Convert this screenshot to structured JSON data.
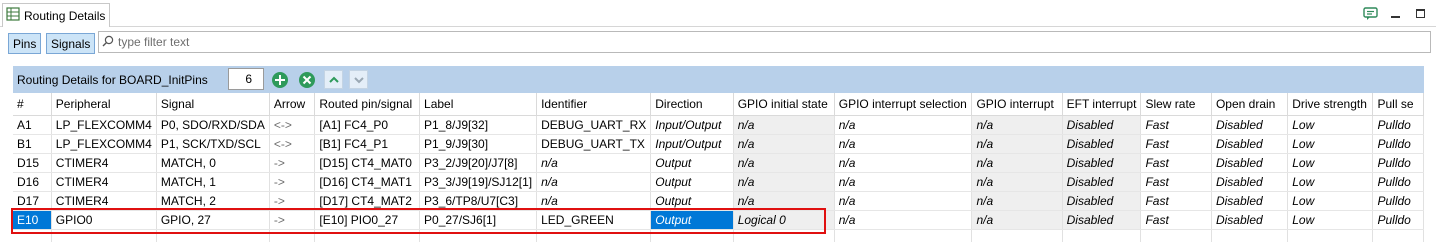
{
  "view": {
    "tab_title": "Routing Details"
  },
  "toolbar": {
    "pins_label": "Pins",
    "signals_label": "Signals",
    "filter_placeholder": "type filter text"
  },
  "routing": {
    "title": "Routing Details for BOARD_InitPins",
    "count": "6"
  },
  "table": {
    "columns": [
      "#",
      "Peripheral",
      "Signal",
      "Arrow",
      "Routed pin/signal",
      "Label",
      "Identifier",
      "Direction",
      "GPIO initial state",
      "GPIO interrupt selection",
      "GPIO interrupt",
      "EFT interrupt",
      "Slew rate",
      "Open drain",
      "Drive strength",
      "Pull se"
    ],
    "rows": [
      [
        "A1",
        "LP_FLEXCOMM4",
        "P0, SDO/RXD/SDA",
        "<->",
        "[A1] FC4_P0",
        "P1_8/J9[32]",
        "DEBUG_UART_RX",
        "Input/Output",
        "n/a",
        "n/a",
        "n/a",
        "Disabled",
        "Fast",
        "Disabled",
        "Low",
        "Pulldo"
      ],
      [
        "B1",
        "LP_FLEXCOMM4",
        "P1, SCK/TXD/SCL",
        "<->",
        "[B1] FC4_P1",
        "P1_9/J9[30]",
        "DEBUG_UART_TX",
        "Input/Output",
        "n/a",
        "n/a",
        "n/a",
        "Disabled",
        "Fast",
        "Disabled",
        "Low",
        "Pulldo"
      ],
      [
        "D15",
        "CTIMER4",
        "MATCH, 0",
        "->",
        "[D15] CT4_MAT0",
        "P3_2/J9[20]/J7[8]",
        "n/a",
        "Output",
        "n/a",
        "n/a",
        "n/a",
        "Disabled",
        "Fast",
        "Disabled",
        "Low",
        "Pulldo"
      ],
      [
        "D16",
        "CTIMER4",
        "MATCH, 1",
        "->",
        "[D16] CT4_MAT1",
        "P3_3/J9[19]/SJ12[1]",
        "n/a",
        "Output",
        "n/a",
        "n/a",
        "n/a",
        "Disabled",
        "Fast",
        "Disabled",
        "Low",
        "Pulldo"
      ],
      [
        "D17",
        "CTIMER4",
        "MATCH, 2",
        "->",
        "[D17] CT4_MAT2",
        "P3_6/TP8/U7[C3]",
        "n/a",
        "Output",
        "n/a",
        "n/a",
        "n/a",
        "Disabled",
        "Fast",
        "Disabled",
        "Low",
        "Pulldo"
      ],
      [
        "E10",
        "GPIO0",
        "GPIO, 27",
        "->",
        "[E10] PIO0_27",
        "P0_27/SJ6[1]",
        "LED_GREEN",
        "Output",
        "Logical 0",
        "n/a",
        "n/a",
        "Disabled",
        "Fast",
        "Disabled",
        "Low",
        "Pulldo"
      ]
    ],
    "selected_row": 5
  },
  "icons": {
    "view_icon": "routing-table-icon",
    "filter_icon": "search-icon",
    "add": "add-icon",
    "remove": "remove-icon",
    "up": "arrow-up-icon",
    "down": "arrow-down-icon"
  },
  "colors": {
    "selection": "#0078d7",
    "header_band": "#b8d0ea",
    "highlight": "#e01010",
    "add_green": "#2e9a5a"
  }
}
